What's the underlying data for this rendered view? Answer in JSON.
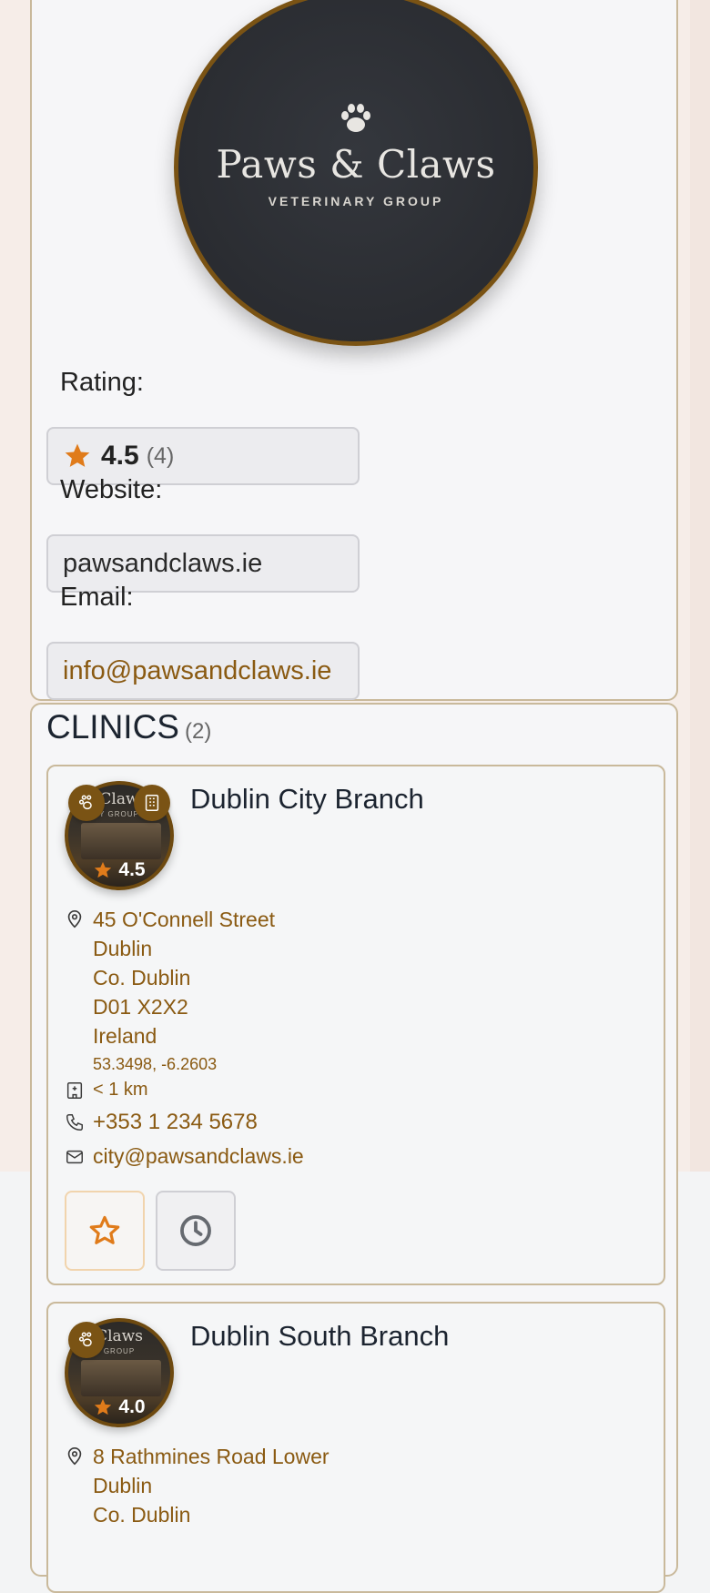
{
  "profile": {
    "logo": {
      "name": "Paws & Claws",
      "subtitle": "VETERINARY GROUP"
    },
    "rating_label": "Rating:",
    "rating_value": "4.5",
    "rating_count": "(4)",
    "website_label": "Website:",
    "website": "pawsandclaws.ie",
    "email_label": "Email:",
    "email": "info@pawsandclaws.ie"
  },
  "clinics": {
    "title": "CLINICS",
    "count": "(2)",
    "items": [
      {
        "name": "Dublin City Branch",
        "rating": "4.5",
        "photo_sign": "Claw",
        "photo_sign_sub": "Y GROUP",
        "address": [
          "45 O'Connell Street",
          "Dublin",
          "Co. Dublin",
          "D01 X2X2",
          "Ireland"
        ],
        "coords": "53.3498, -6.2603",
        "distance": "< 1 km",
        "phone": "+353 1 234 5678",
        "email": "city@pawsandclaws.ie"
      },
      {
        "name": "Dublin South Branch",
        "rating": "4.0",
        "photo_sign": "Claws",
        "photo_sign_sub": "GROUP",
        "address": [
          "8 Rathmines Road Lower",
          "Dublin",
          "Co. Dublin"
        ]
      }
    ]
  },
  "colors": {
    "accent": "#8a5a12",
    "brand_brown": "#7a5314",
    "star": "#e07b1a",
    "border": "#c9b99b"
  },
  "icons": [
    "paw-icon",
    "star-icon",
    "building-icon",
    "map-pin-icon",
    "hospital-icon",
    "phone-icon",
    "mail-icon",
    "clock-icon"
  ]
}
